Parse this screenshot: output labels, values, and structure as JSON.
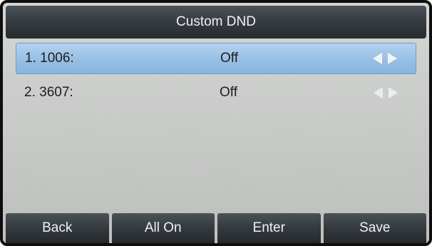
{
  "title": "Custom DND",
  "rows": [
    {
      "label": "1. 1006:",
      "value": "Off",
      "selected": true
    },
    {
      "label": "2. 3607:",
      "value": "Off",
      "selected": false
    }
  ],
  "softkeys": [
    "Back",
    "All On",
    "Enter",
    "Save"
  ],
  "colors": {
    "title_bar": "#353b40",
    "selection": "#97bfe4",
    "background": "#c9cbc9",
    "softkey": "#343a3f"
  }
}
